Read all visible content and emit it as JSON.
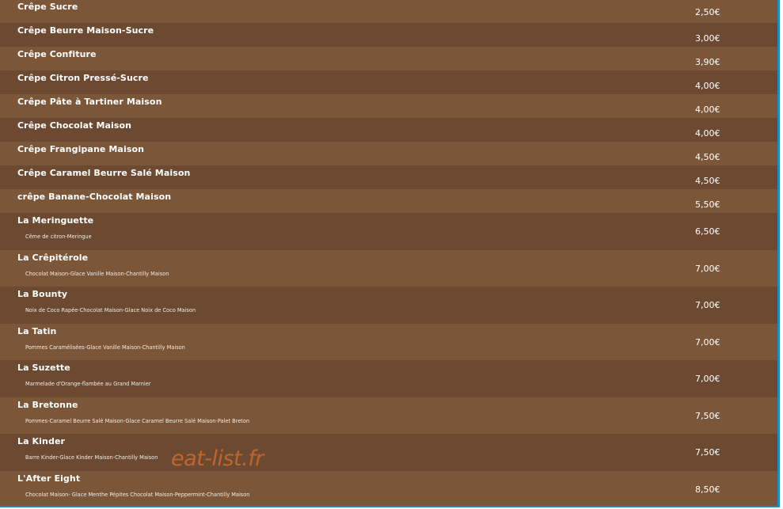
{
  "menu": {
    "items": [
      {
        "name": "Crêpe Sucre",
        "price": "2,50€"
      },
      {
        "name": "Crêpe Beurre Maison-Sucre",
        "price": "3,00€"
      },
      {
        "name": "Crêpe Confiture",
        "price": "3,90€"
      },
      {
        "name": "Crêpe Citron Pressé-Sucre",
        "price": "4,00€"
      },
      {
        "name": "Crêpe Pâte à Tartiner Maison",
        "price": "4,00€"
      },
      {
        "name": "Crêpe Chocolat Maison",
        "price": "4,00€"
      },
      {
        "name": "Crêpe Frangipane Maison",
        "price": "4,50€"
      },
      {
        "name": "Crêpe Caramel Beurre Salé Maison",
        "price": "4,50€"
      },
      {
        "name": "crêpe Banane-Chocolat Maison",
        "price": "5,50€"
      },
      {
        "name": "La Meringuette",
        "description": "Cême de citron-Meringue",
        "price": "6,50€"
      },
      {
        "name": "La Crêpitérole",
        "description": "Chocolat Maison-Glace Vanille Maison-Chantilly Maison",
        "price": "7,00€"
      },
      {
        "name": "La Bounty",
        "description": "Noix de Coco Rapée-Chocolat Maison-Glace Noix de Coco Maison",
        "price": "7,00€"
      },
      {
        "name": "La Tatin",
        "description": "Pommes Caramélisées-Glace Vanille Maison-Chantilly Maison",
        "price": "7,00€"
      },
      {
        "name": "La Suzette",
        "description": "Marmelade d'Orange-flambée au Grand Marnier",
        "price": "7,00€"
      },
      {
        "name": "La Bretonne",
        "description": "Pommes-Caramel Beurre Salé Maison-Glace Caramel Beurre Salé Maison-Palet Breton",
        "price": "7,50€"
      },
      {
        "name": "La Kinder",
        "description": "Barre Kinder-Glace Kinder Maison-Chantilly Maison",
        "price": "7,50€"
      },
      {
        "name": "L'After Eight",
        "description": "Chocolat Maison- Glace Menthe Pépites Chocolat Maison-Peppermint-Chantilly Maison",
        "price": "8,50€"
      }
    ]
  },
  "watermark": "eat-list.fr",
  "colors": {
    "row_dark": "#6b4a31",
    "row_light": "#7b5638",
    "text": "#ffffff",
    "watermark": "#d26a2c",
    "border": "#1c8fbf"
  }
}
